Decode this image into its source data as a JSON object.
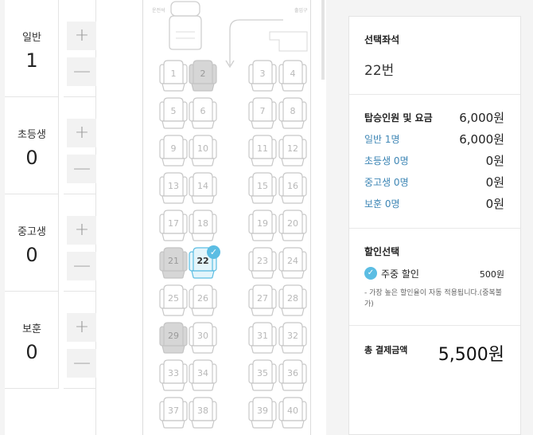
{
  "passengers": [
    {
      "label": "일반",
      "count": "1",
      "plus": "+",
      "minus": "—"
    },
    {
      "label": "초등생",
      "count": "0",
      "plus": "+",
      "minus": "—"
    },
    {
      "label": "중고생",
      "count": "0",
      "plus": "+",
      "minus": "—"
    },
    {
      "label": "보훈",
      "count": "0",
      "plus": "+",
      "minus": "—"
    }
  ],
  "bus": {
    "front_left": "운전석",
    "front_right": "출입구",
    "seats": [
      {
        "n": "1",
        "s": "available"
      },
      {
        "n": "2",
        "s": "sold"
      },
      {
        "n": "3",
        "s": "available"
      },
      {
        "n": "4",
        "s": "available"
      },
      {
        "n": "5",
        "s": "available"
      },
      {
        "n": "6",
        "s": "available"
      },
      {
        "n": "7",
        "s": "available"
      },
      {
        "n": "8",
        "s": "available"
      },
      {
        "n": "9",
        "s": "available"
      },
      {
        "n": "10",
        "s": "available"
      },
      {
        "n": "11",
        "s": "available"
      },
      {
        "n": "12",
        "s": "available"
      },
      {
        "n": "13",
        "s": "available"
      },
      {
        "n": "14",
        "s": "available"
      },
      {
        "n": "15",
        "s": "available"
      },
      {
        "n": "16",
        "s": "available"
      },
      {
        "n": "17",
        "s": "available"
      },
      {
        "n": "18",
        "s": "available"
      },
      {
        "n": "19",
        "s": "available"
      },
      {
        "n": "20",
        "s": "available"
      },
      {
        "n": "21",
        "s": "sold"
      },
      {
        "n": "22",
        "s": "selected"
      },
      {
        "n": "23",
        "s": "available"
      },
      {
        "n": "24",
        "s": "available"
      },
      {
        "n": "25",
        "s": "available"
      },
      {
        "n": "26",
        "s": "available"
      },
      {
        "n": "27",
        "s": "available"
      },
      {
        "n": "28",
        "s": "available"
      },
      {
        "n": "29",
        "s": "sold"
      },
      {
        "n": "30",
        "s": "available"
      },
      {
        "n": "31",
        "s": "available"
      },
      {
        "n": "32",
        "s": "available"
      },
      {
        "n": "33",
        "s": "available"
      },
      {
        "n": "34",
        "s": "available"
      },
      {
        "n": "35",
        "s": "available"
      },
      {
        "n": "36",
        "s": "available"
      },
      {
        "n": "37",
        "s": "available"
      },
      {
        "n": "38",
        "s": "available"
      },
      {
        "n": "39",
        "s": "available"
      },
      {
        "n": "40",
        "s": "available"
      }
    ],
    "selected_check": "✓"
  },
  "summary": {
    "seat_title": "선택좌석",
    "seat_value": "22번",
    "fare_title": "탑승인원 및 요금",
    "fare_total": "6,000원",
    "fares": [
      {
        "label": "일반 1명",
        "value": "6,000원"
      },
      {
        "label": "초등생 0명",
        "value": "0원"
      },
      {
        "label": "중고생 0명",
        "value": "0원"
      },
      {
        "label": "보훈 0명",
        "value": "0원"
      }
    ],
    "discount_title": "할인선택",
    "discount_check": "✓",
    "discount_name": "주중 할인",
    "discount_amount": "500원",
    "discount_note": "- 가장 높은 할인율이 자동 적용됩니다.(중복불가)",
    "total_label": "총 결제금액",
    "total_value": "5,500원"
  },
  "colors": {
    "accent": "#5bbde3",
    "link": "#3e86b5",
    "sold": "#d6d6d6",
    "selected_fill": "#e4f5fb"
  }
}
